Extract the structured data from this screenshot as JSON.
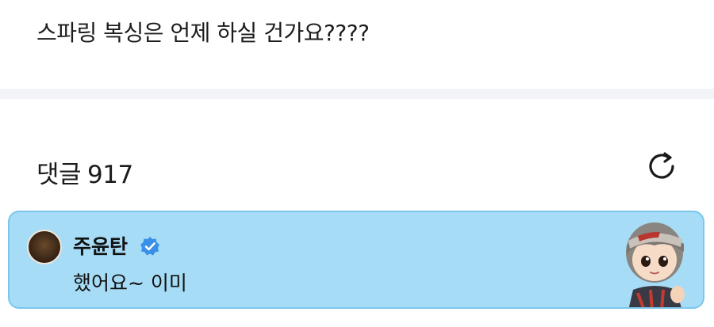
{
  "post": {
    "text": "스파링 복싱은 언제 하실 건가요????"
  },
  "comments": {
    "label": "댓글",
    "count": "917",
    "items": [
      {
        "author": "주윤탄",
        "verified": true,
        "text": "했어요~ 이미"
      }
    ]
  },
  "icons": {
    "refresh": "refresh-icon",
    "verified": "verified-badge-icon"
  },
  "colors": {
    "card_bg": "#a6dcf6",
    "verified": "#3a8fe8"
  }
}
